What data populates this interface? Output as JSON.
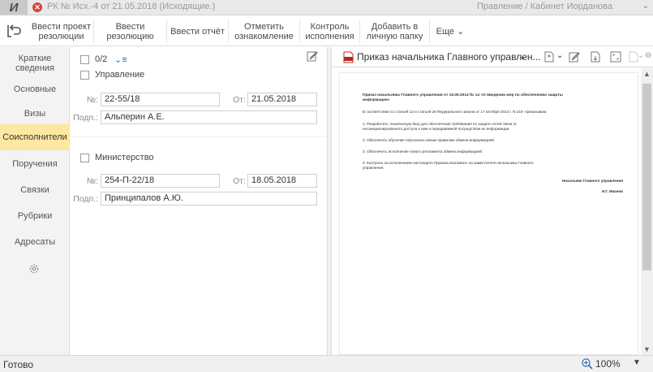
{
  "window": {
    "app_letter": "И",
    "doc_title": "РК № Исх.-4 от 21.05.2018 (Исходящие.)",
    "user_title": "Правление / Кабинет Иорданова"
  },
  "toolbar": {
    "buttons": [
      {
        "label": "Ввести проект\nрезолюции"
      },
      {
        "label": "Ввести\nрезолюцию"
      },
      {
        "label": "Ввести отчёт"
      },
      {
        "label": "Отметить\nознакомление"
      },
      {
        "label": "Контроль\nисполнения"
      },
      {
        "label": "Добавить в\nличную папку"
      },
      {
        "label": "Еще ⌄"
      }
    ]
  },
  "nav": {
    "items": [
      {
        "label": "Краткие\nсведения"
      },
      {
        "label": "Основные"
      },
      {
        "label": "Визы"
      },
      {
        "label": "Соисполнители",
        "active": true
      },
      {
        "label": "Поручения"
      },
      {
        "label": "Связки"
      },
      {
        "label": "Рубрики"
      },
      {
        "label": "Адресаты"
      }
    ],
    "settings_icon": "gear-icon"
  },
  "executors": {
    "counter": "0/2",
    "sort_glyph": "⌄≡",
    "groups": [
      {
        "org": "Управление",
        "num_label": "№:",
        "num_value": "22-55/18",
        "date_label": "От:",
        "date_value": "21.05.2018",
        "sign_label": "Подп.:",
        "sign_value": "Альперин А.Е."
      },
      {
        "org": "Министерство",
        "num_label": "№:",
        "num_value": "254-П-22/18",
        "date_label": "От:",
        "date_value": "18.05.2018",
        "sign_label": "Подп.:",
        "sign_value": "Принципалов А.Ю."
      }
    ]
  },
  "viewer": {
    "doc_name": "Приказ начальника Главного управлен...",
    "lines": [
      "Приказ начальника Главного управления от 15.09.2014 № 14 «О введении мер по обеспечению защиты",
      "информации»",
      "В соответствии со статьей 12 и статьей 26 Федерального закона от 17 октября 2014 г. N 215- приказываю:",
      "1. Разработать техническую базу для обеспечения требования по защите сетей связи от",
      "несанкционированного доступа к ним и передаваемой посредством их информации.",
      "2. Обеспечить обучение персонала новым правилам обмена информацией.",
      "3. Обеспечить исполнение нового регламента обмена информацией.",
      "3. Контроль за исполнением настоящего Приказа возложить на заместителя  начальника Главного",
      "управления.",
      "Начальник Главного управления",
      "И.Г. Иванов"
    ]
  },
  "status": {
    "text": "Готово",
    "zoom": "100%"
  }
}
